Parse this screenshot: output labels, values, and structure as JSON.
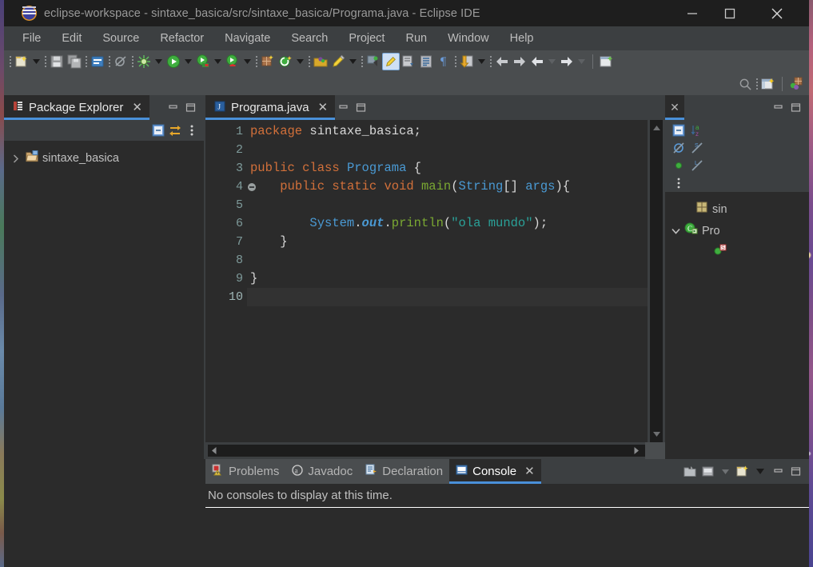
{
  "window": {
    "title": "eclipse-workspace - sintaxe_basica/src/sintaxe_basica/Programa.java - Eclipse IDE",
    "logo_icon": "eclipse-logo-icon",
    "minimize_icon": "minimize-icon",
    "maximize_icon": "maximize-icon",
    "close_icon": "close-icon"
  },
  "menu": {
    "items": [
      {
        "label": "File"
      },
      {
        "label": "Edit"
      },
      {
        "label": "Source"
      },
      {
        "label": "Refactor"
      },
      {
        "label": "Navigate"
      },
      {
        "label": "Search"
      },
      {
        "label": "Project"
      },
      {
        "label": "Run"
      },
      {
        "label": "Window"
      },
      {
        "label": "Help"
      }
    ]
  },
  "toolbar": {
    "items": [
      {
        "name": "new-wizard-icon"
      },
      {
        "name": "new-wizard-dropdown-icon"
      },
      {
        "name": "save-icon"
      },
      {
        "name": "save-all-icon"
      },
      {
        "name": "new-java-package-icon"
      },
      {
        "name": "quick-access-icon"
      },
      {
        "name": "debug-icon"
      },
      {
        "name": "debug-dropdown-icon"
      },
      {
        "name": "run-icon"
      },
      {
        "name": "run-dropdown-icon"
      },
      {
        "name": "run-external-tools-icon"
      },
      {
        "name": "external-tools-dropdown-icon"
      },
      {
        "name": "coverage-icon"
      },
      {
        "name": "coverage-dropdown-icon"
      },
      {
        "name": "new-java-class-icon"
      },
      {
        "name": "new-annotation-icon"
      },
      {
        "name": "new-type-dropdown-icon"
      },
      {
        "name": "open-type-icon"
      },
      {
        "name": "search-marker-icon"
      },
      {
        "name": "search-dropdown-icon"
      },
      {
        "name": "toggle-mark-occurrences-icon"
      },
      {
        "name": "skip-breakpoints-icon"
      },
      {
        "name": "next-annotation-icon"
      },
      {
        "name": "last-edit-location-icon"
      },
      {
        "name": "show-whitespace-icon"
      },
      {
        "name": "previous-edit-icon"
      },
      {
        "name": "next-edit-dropdown-icon"
      },
      {
        "name": "back-icon"
      },
      {
        "name": "forward-icon"
      },
      {
        "name": "back-history-icon"
      },
      {
        "name": "back-history-dropdown-icon"
      },
      {
        "name": "forward-history-icon"
      },
      {
        "name": "forward-history-dropdown-icon"
      },
      {
        "name": "open-perspective-icon"
      }
    ]
  },
  "toolbar2": {
    "items": [
      {
        "name": "search-icon"
      },
      {
        "name": "open-perspective-icon"
      },
      {
        "name": "java-perspective-icon"
      }
    ]
  },
  "package_explorer": {
    "tab_label": "Package Explorer",
    "tab_icon": "package-explorer-icon",
    "close_icon": "close-icon",
    "minimize_icon": "minimize-icon",
    "maximize_icon": "maximize-icon",
    "toolbar": [
      {
        "name": "collapse-all-icon"
      },
      {
        "name": "link-with-editor-icon"
      },
      {
        "name": "view-menu-icon"
      }
    ],
    "tree": [
      {
        "label": "sintaxe_basica",
        "icon": "java-project-icon",
        "expand_icon": "chevron-right-icon",
        "expanded": false
      }
    ]
  },
  "editor": {
    "tab_label": "Programa.java",
    "tab_icon": "java-file-icon",
    "close_icon": "close-icon",
    "minimize_icon": "minimize-icon",
    "maximize_icon": "maximize-icon",
    "current_line": 10,
    "line_numbers": [
      "1",
      "2",
      "3",
      "4",
      "5",
      "6",
      "7",
      "8",
      "9",
      "10"
    ],
    "folding_line": 4,
    "code_lines": [
      {
        "n": 1,
        "tokens": [
          {
            "t": "package",
            "c": "kw"
          },
          {
            "t": " sintaxe_basica;",
            "c": "pl"
          }
        ]
      },
      {
        "n": 2,
        "tokens": []
      },
      {
        "n": 3,
        "tokens": [
          {
            "t": "public",
            "c": "kw"
          },
          {
            "t": " ",
            "c": "pl"
          },
          {
            "t": "class",
            "c": "kw"
          },
          {
            "t": " ",
            "c": "pl"
          },
          {
            "t": "Programa",
            "c": "type"
          },
          {
            "t": " {",
            "c": "pl"
          }
        ]
      },
      {
        "n": 4,
        "tokens": [
          {
            "t": "    ",
            "c": "pl"
          },
          {
            "t": "public",
            "c": "kw"
          },
          {
            "t": " ",
            "c": "pl"
          },
          {
            "t": "static",
            "c": "kw"
          },
          {
            "t": " ",
            "c": "pl"
          },
          {
            "t": "void",
            "c": "kw"
          },
          {
            "t": " ",
            "c": "pl"
          },
          {
            "t": "main",
            "c": "meth"
          },
          {
            "t": "(",
            "c": "pl"
          },
          {
            "t": "String",
            "c": "type"
          },
          {
            "t": "[] ",
            "c": "pl"
          },
          {
            "t": "args",
            "c": "type"
          },
          {
            "t": "){",
            "c": "pl"
          }
        ]
      },
      {
        "n": 5,
        "tokens": []
      },
      {
        "n": 6,
        "tokens": [
          {
            "t": "        ",
            "c": "pl"
          },
          {
            "t": "System",
            "c": "type"
          },
          {
            "t": ".",
            "c": "pl"
          },
          {
            "t": "out",
            "c": "fieldi"
          },
          {
            "t": ".",
            "c": "pl"
          },
          {
            "t": "println",
            "c": "meth"
          },
          {
            "t": "(",
            "c": "pl"
          },
          {
            "t": "\"ola mundo\"",
            "c": "str"
          },
          {
            "t": ");",
            "c": "pl"
          }
        ]
      },
      {
        "n": 7,
        "tokens": [
          {
            "t": "    }",
            "c": "pl"
          }
        ]
      },
      {
        "n": 8,
        "tokens": []
      },
      {
        "n": 9,
        "tokens": [
          {
            "t": "}",
            "c": "pl"
          }
        ]
      },
      {
        "n": 10,
        "tokens": []
      }
    ],
    "vscroll_up_icon": "scroll-up-arrow-icon",
    "vscroll_down_icon": "scroll-down-arrow-icon",
    "hscroll_left_icon": "scroll-left-arrow-icon",
    "hscroll_right_icon": "scroll-right-arrow-icon"
  },
  "outline": {
    "close_icon": "close-icon",
    "minimize_icon": "minimize-icon",
    "maximize_icon": "maximize-icon",
    "toolbar": [
      {
        "name": "collapse-all-icon"
      },
      {
        "name": "sort-alphabetically-icon"
      },
      {
        "name": "hide-fields-icon"
      },
      {
        "name": "hide-static-icon"
      },
      {
        "name": "hide-non-public-icon"
      },
      {
        "name": "hide-local-types-icon"
      },
      {
        "name": "view-menu-icon"
      }
    ],
    "tree": [
      {
        "label": "sin",
        "icon": "package-icon",
        "indent": 1,
        "expand_icon": ""
      },
      {
        "label": "Pro",
        "icon": "java-class-icon",
        "indent": 0,
        "expand_icon": "chevron-down-icon"
      },
      {
        "label": "",
        "icon": "method-static-icon",
        "indent": 2,
        "expand_icon": ""
      }
    ]
  },
  "bottom_panel": {
    "tabs": [
      {
        "label": "Problems",
        "icon": "problems-icon",
        "active": false
      },
      {
        "label": "Javadoc",
        "icon": "javadoc-icon",
        "active": false
      },
      {
        "label": "Declaration",
        "icon": "declaration-icon",
        "active": false
      },
      {
        "label": "Console",
        "icon": "console-icon",
        "active": true,
        "close_icon": "close-icon"
      }
    ],
    "message": "No consoles to display at this time.",
    "toolbar": [
      {
        "name": "open-console-icon"
      },
      {
        "name": "display-selected-console-icon"
      },
      {
        "name": "display-console-dropdown-icon"
      },
      {
        "name": "new-console-view-icon"
      },
      {
        "name": "console-view-dropdown-icon"
      }
    ],
    "minimize_icon": "minimize-icon",
    "maximize_icon": "maximize-icon"
  },
  "colors": {
    "accent": "#4a90d9",
    "editor_bg": "#2b2b2b",
    "panel_bg": "#3c3f41",
    "toolbar_bg": "#4a4d4f",
    "keyword": "#d2703a",
    "type": "#4a9ad4",
    "method": "#7aa832",
    "string": "#2aa198",
    "line_number": "#7e9a9a"
  }
}
